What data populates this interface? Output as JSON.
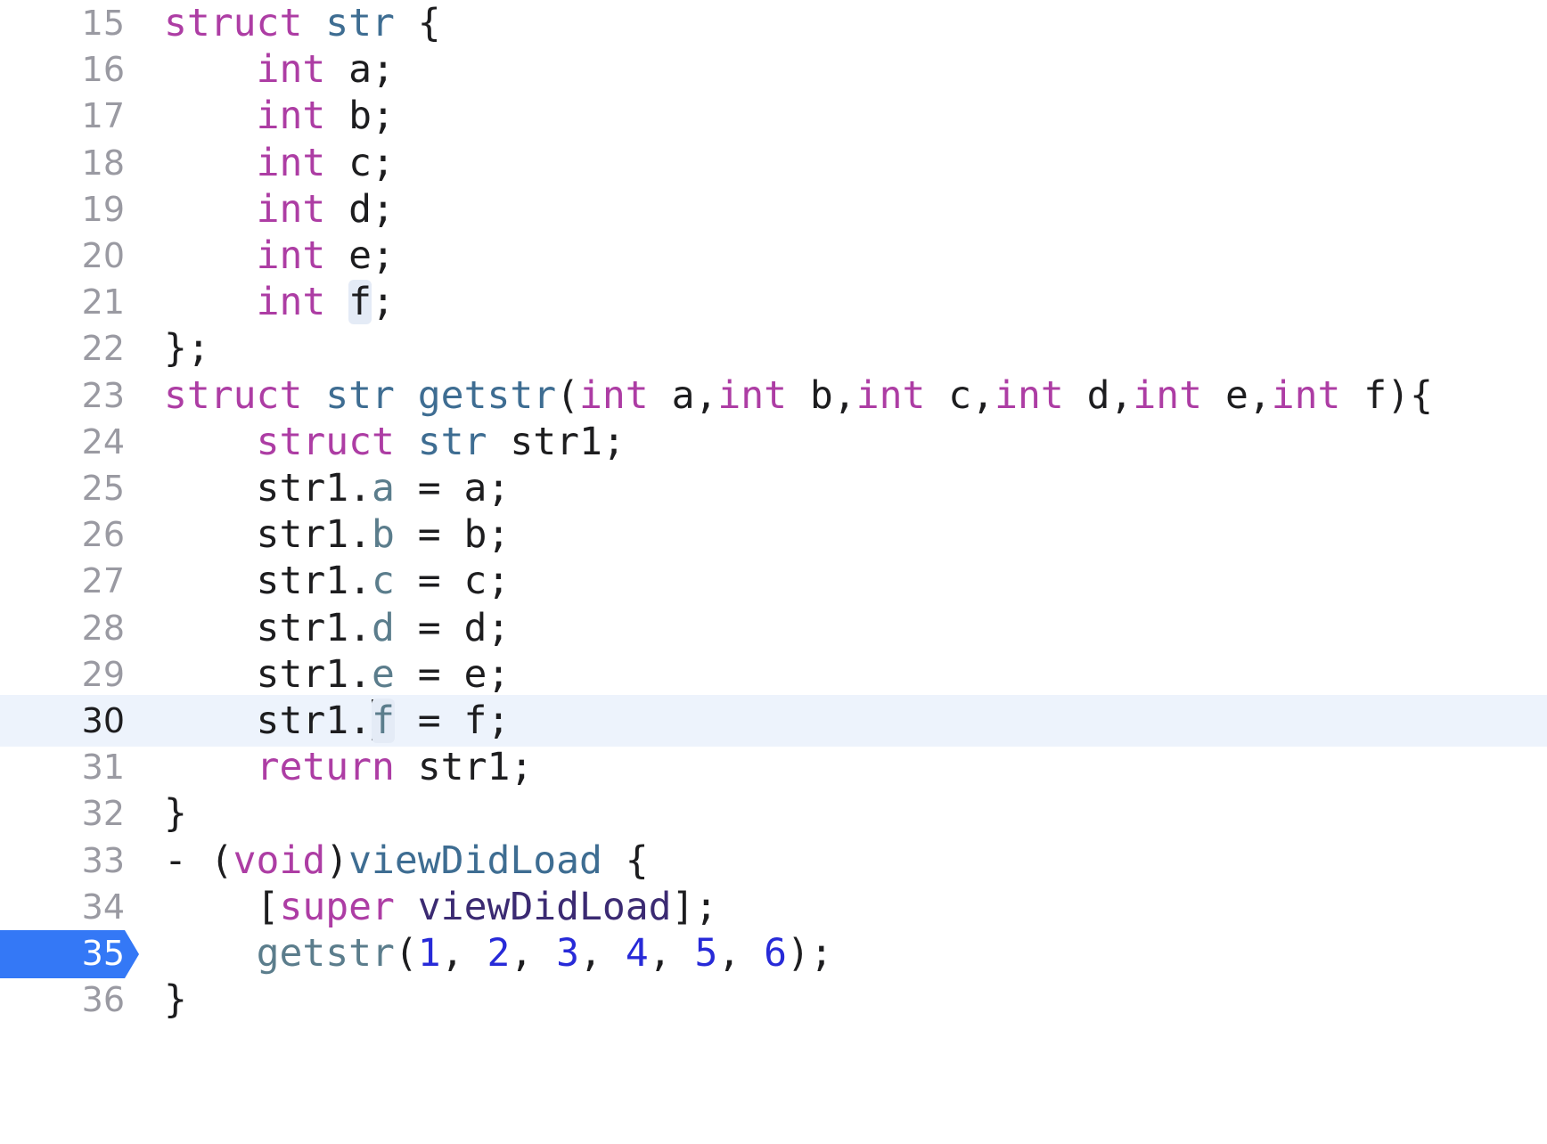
{
  "editor": {
    "lines": [
      {
        "n": "15",
        "tokens": [
          {
            "t": "struct",
            "c": "kw"
          },
          {
            "t": " "
          },
          {
            "t": "str",
            "c": "ty"
          },
          {
            "t": " {"
          }
        ]
      },
      {
        "n": "16",
        "tokens": [
          {
            "t": "    "
          },
          {
            "t": "int",
            "c": "kw"
          },
          {
            "t": " a;"
          }
        ]
      },
      {
        "n": "17",
        "tokens": [
          {
            "t": "    "
          },
          {
            "t": "int",
            "c": "kw"
          },
          {
            "t": " b;"
          }
        ]
      },
      {
        "n": "18",
        "tokens": [
          {
            "t": "    "
          },
          {
            "t": "int",
            "c": "kw"
          },
          {
            "t": " c;"
          }
        ]
      },
      {
        "n": "19",
        "tokens": [
          {
            "t": "    "
          },
          {
            "t": "int",
            "c": "kw"
          },
          {
            "t": " d;"
          }
        ]
      },
      {
        "n": "20",
        "tokens": [
          {
            "t": "    "
          },
          {
            "t": "int",
            "c": "kw"
          },
          {
            "t": " e;"
          }
        ]
      },
      {
        "n": "21",
        "tokens": [
          {
            "t": "    "
          },
          {
            "t": "int",
            "c": "kw"
          },
          {
            "t": " "
          },
          {
            "t": "f",
            "c": "hl"
          },
          {
            "t": ";"
          }
        ]
      },
      {
        "n": "22",
        "tokens": [
          {
            "t": "};"
          }
        ]
      },
      {
        "n": "23",
        "tokens": [
          {
            "t": "struct",
            "c": "kw"
          },
          {
            "t": " "
          },
          {
            "t": "str",
            "c": "ty"
          },
          {
            "t": " "
          },
          {
            "t": "getstr",
            "c": "fn"
          },
          {
            "t": "("
          },
          {
            "t": "int",
            "c": "kw"
          },
          {
            "t": " a,"
          },
          {
            "t": "int",
            "c": "kw"
          },
          {
            "t": " b,"
          },
          {
            "t": "int",
            "c": "kw"
          },
          {
            "t": " c,"
          },
          {
            "t": "int",
            "c": "kw"
          },
          {
            "t": " d,"
          },
          {
            "t": "int",
            "c": "kw"
          },
          {
            "t": " e,"
          },
          {
            "t": "int",
            "c": "kw"
          },
          {
            "t": " f){"
          }
        ]
      },
      {
        "n": "24",
        "tokens": [
          {
            "t": "    "
          },
          {
            "t": "struct",
            "c": "kw"
          },
          {
            "t": " "
          },
          {
            "t": "str",
            "c": "ty"
          },
          {
            "t": " str1;"
          }
        ]
      },
      {
        "n": "25",
        "tokens": [
          {
            "t": "    str1."
          },
          {
            "t": "a",
            "c": "mem"
          },
          {
            "t": " = a;"
          }
        ]
      },
      {
        "n": "26",
        "tokens": [
          {
            "t": "    str1."
          },
          {
            "t": "b",
            "c": "mem"
          },
          {
            "t": " = b;"
          }
        ]
      },
      {
        "n": "27",
        "tokens": [
          {
            "t": "    str1."
          },
          {
            "t": "c",
            "c": "mem"
          },
          {
            "t": " = c;"
          }
        ]
      },
      {
        "n": "28",
        "tokens": [
          {
            "t": "    str1."
          },
          {
            "t": "d",
            "c": "mem"
          },
          {
            "t": " = d;"
          }
        ]
      },
      {
        "n": "29",
        "tokens": [
          {
            "t": "    str1."
          },
          {
            "t": "e",
            "c": "mem"
          },
          {
            "t": " = e;"
          }
        ]
      },
      {
        "n": "30",
        "current": true,
        "tokens": [
          {
            "t": "    str1."
          },
          {
            "t": "",
            "c": "caret"
          },
          {
            "t": "f",
            "c": "mem hl"
          },
          {
            "t": " = f;"
          }
        ]
      },
      {
        "n": "31",
        "tokens": [
          {
            "t": "    "
          },
          {
            "t": "return",
            "c": "kw"
          },
          {
            "t": " str1;"
          }
        ]
      },
      {
        "n": "32",
        "tokens": [
          {
            "t": "}"
          }
        ]
      },
      {
        "n": "33",
        "tokens": [
          {
            "t": "- ("
          },
          {
            "t": "void",
            "c": "kw"
          },
          {
            "t": ")"
          },
          {
            "t": "viewDidLoad",
            "c": "fn"
          },
          {
            "t": " {"
          }
        ]
      },
      {
        "n": "34",
        "tokens": [
          {
            "t": "    ["
          },
          {
            "t": "super",
            "c": "kw"
          },
          {
            "t": " "
          },
          {
            "t": "viewDidLoad",
            "c": "cls"
          },
          {
            "t": "];"
          }
        ]
      },
      {
        "n": "35",
        "breakpoint": true,
        "tokens": [
          {
            "t": "    "
          },
          {
            "t": "getstr",
            "c": "mem"
          },
          {
            "t": "("
          },
          {
            "t": "1",
            "c": "num-lit"
          },
          {
            "t": ", "
          },
          {
            "t": "2",
            "c": "num-lit"
          },
          {
            "t": ", "
          },
          {
            "t": "3",
            "c": "num-lit"
          },
          {
            "t": ", "
          },
          {
            "t": "4",
            "c": "num-lit"
          },
          {
            "t": ", "
          },
          {
            "t": "5",
            "c": "num-lit"
          },
          {
            "t": ", "
          },
          {
            "t": "6",
            "c": "num-lit"
          },
          {
            "t": ");"
          }
        ]
      },
      {
        "n": "36",
        "tokens": [
          {
            "t": "}"
          }
        ]
      }
    ]
  }
}
